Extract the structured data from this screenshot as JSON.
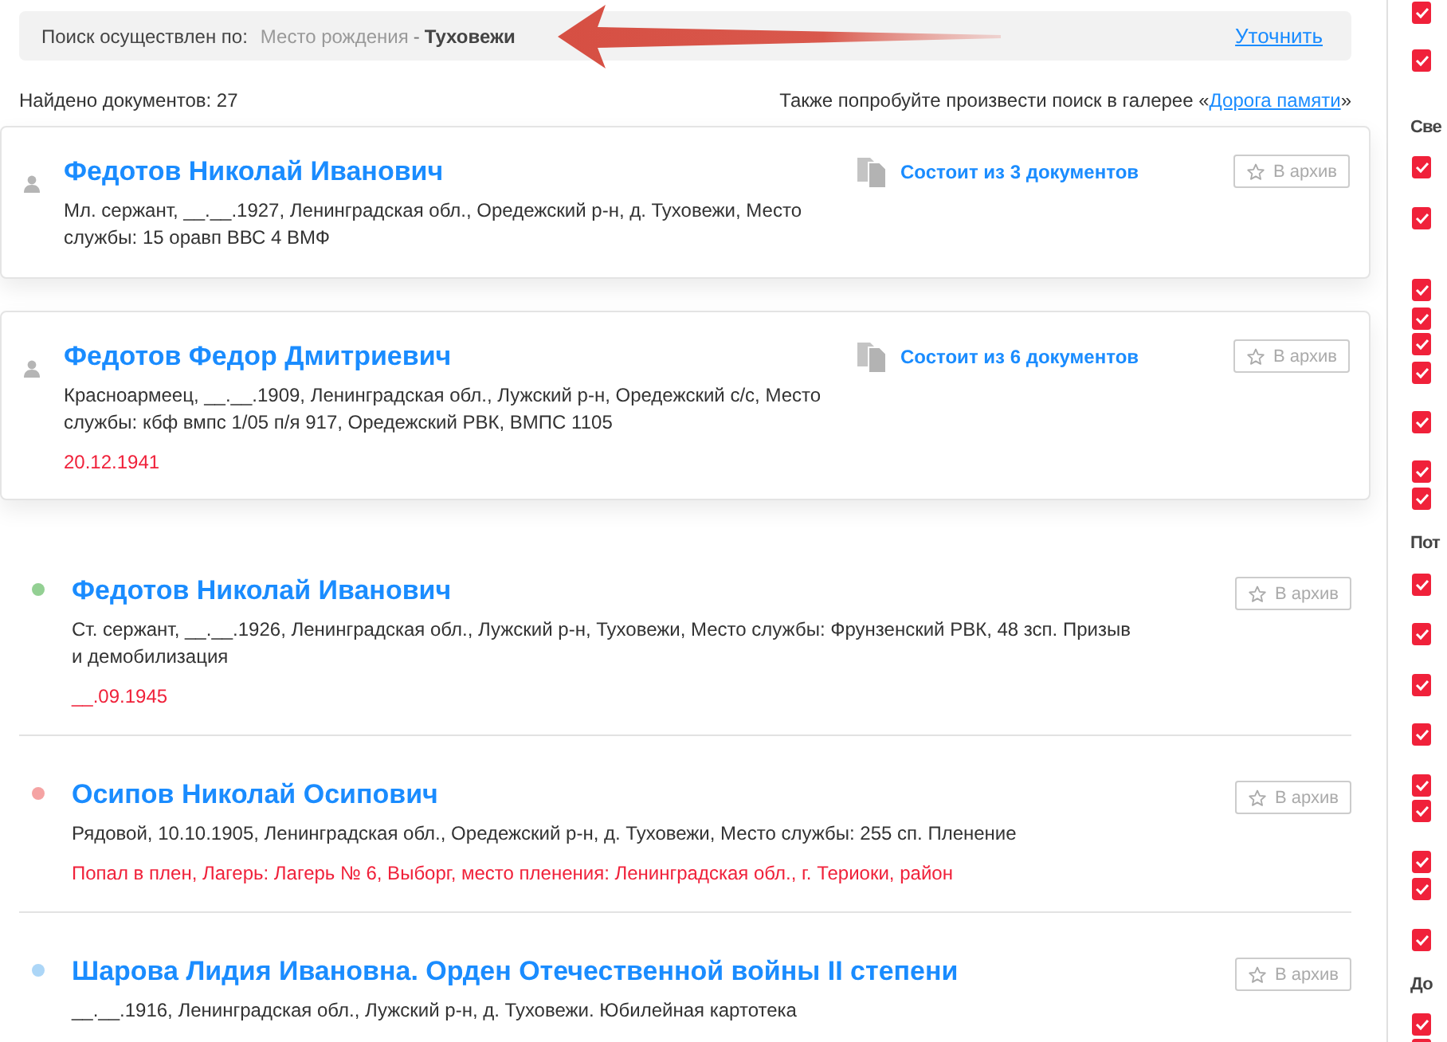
{
  "search_bar": {
    "label": "Поиск осуществлен по:",
    "field": "Место рождения",
    "separator": "-",
    "value": "Туховежи",
    "refine_link": "Уточнить"
  },
  "found": {
    "count_text": "Найдено документов: 27",
    "gallery_prefix": "Также попробуйте произвести поиск в галерее «",
    "gallery_link": "Дорога памяти",
    "gallery_suffix": "»"
  },
  "results": [
    {
      "kind": "group",
      "name": "Федотов Николай Иванович",
      "description": "Мл. сержант, __.__.1927, Ленинградская обл., Оредежский р-н, д. Туховежи, Место службы: 15 оравп ВВС 4 ВМФ",
      "documents": "Состоит из 3 документов",
      "archive": "В архив"
    },
    {
      "kind": "group",
      "name": "Федотов Федор Дмитриевич",
      "description": "Красноармеец, __.__.1909, Ленинградская обл., Лужский р-н, Оредежский с/с, Место службы: кбф вмпс 1/05 п/я 917, Оредежский РВК, ВМПС 1105",
      "note": "20.12.1941",
      "documents": "Состоит из 6 документов",
      "archive": "В архив"
    },
    {
      "kind": "record",
      "color": "#93d093",
      "name": "Федотов Николай Иванович",
      "description": "Ст. сержант, __.__.1926, Ленинградская обл., Лужский р-н, Туховежи, Место службы: Фрунзенский РВК, 48 зсп. Призыв и демобилизация",
      "note": "__.09.1945",
      "archive": "В архив"
    },
    {
      "kind": "record",
      "color": "#f5a3a3",
      "name": "Осипов Николай Осипович",
      "description": "Рядовой, 10.10.1905, Ленинградская обл., Оредежский р-н, д. Туховежи, Место службы: 255 сп. Пленение",
      "note": "Попал в плен, Лагерь: Лагерь № 6, Выборг, место пленения: Ленинградская обл., г. Териоки, район",
      "archive": "В архив"
    },
    {
      "kind": "record",
      "color": "#acd6f7",
      "name": "Шарова Лидия Ивановна. Орден Отечественной войны II степени",
      "description": "__.__.1916, Ленинградская обл., Лужский р-н, д. Туховежи. Юбилейная картотека",
      "archive": "В архив"
    }
  ],
  "filters": [
    {
      "kind": "checkbox",
      "checked": true
    },
    {
      "kind": "checkbox",
      "checked": true
    },
    {
      "kind": "heading",
      "label": "Све"
    },
    {
      "kind": "checkbox",
      "checked": true
    },
    {
      "kind": "checkbox",
      "checked": true
    },
    {
      "kind": "checkbox",
      "checked": true
    },
    {
      "kind": "checkbox",
      "checked": true
    },
    {
      "kind": "checkbox",
      "checked": true
    },
    {
      "kind": "checkbox",
      "checked": true
    },
    {
      "kind": "checkbox",
      "checked": true
    },
    {
      "kind": "checkbox",
      "checked": true
    },
    {
      "kind": "checkbox",
      "checked": true
    },
    {
      "kind": "heading",
      "label": "Пот"
    },
    {
      "kind": "checkbox",
      "checked": true
    },
    {
      "kind": "checkbox",
      "checked": true
    },
    {
      "kind": "checkbox",
      "checked": true
    },
    {
      "kind": "checkbox",
      "checked": true
    },
    {
      "kind": "checkbox",
      "checked": true
    },
    {
      "kind": "checkbox",
      "checked": true
    },
    {
      "kind": "checkbox",
      "checked": true
    },
    {
      "kind": "checkbox",
      "checked": true
    },
    {
      "kind": "checkbox",
      "checked": true
    },
    {
      "kind": "heading",
      "label": "До"
    },
    {
      "kind": "checkbox",
      "checked": true
    },
    {
      "kind": "checkbox",
      "checked": true
    }
  ]
}
